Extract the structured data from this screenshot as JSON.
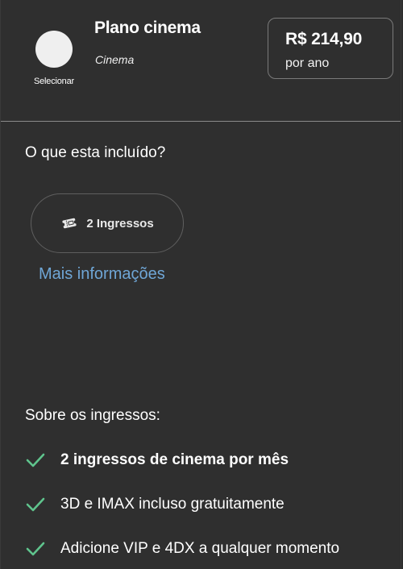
{
  "plan": {
    "select_label": "Selecionar",
    "title": "Plano cinema",
    "subtitle": "Cinema",
    "price_amount": "R$ 214,90",
    "price_period": "por ano"
  },
  "included": {
    "title": "O que esta incluído?",
    "chip_label": "2 Ingressos",
    "chip_icon": "ticket-icon",
    "more_info": "Mais informações"
  },
  "about": {
    "title": "Sobre os ingressos:",
    "benefits": [
      {
        "text": "2 ingressos de cinema por mês",
        "icon": "check-icon"
      },
      {
        "text": "3D e IMAX incluso gratuitamente",
        "icon": "check-icon"
      },
      {
        "text": "Adicione VIP e 4DX a qualquer momento",
        "icon": "check-icon"
      }
    ]
  },
  "colors": {
    "background": "#2f2f2f",
    "link": "#6fa6d6",
    "check": "#5fc48d",
    "divider": "#8a8a8a"
  }
}
